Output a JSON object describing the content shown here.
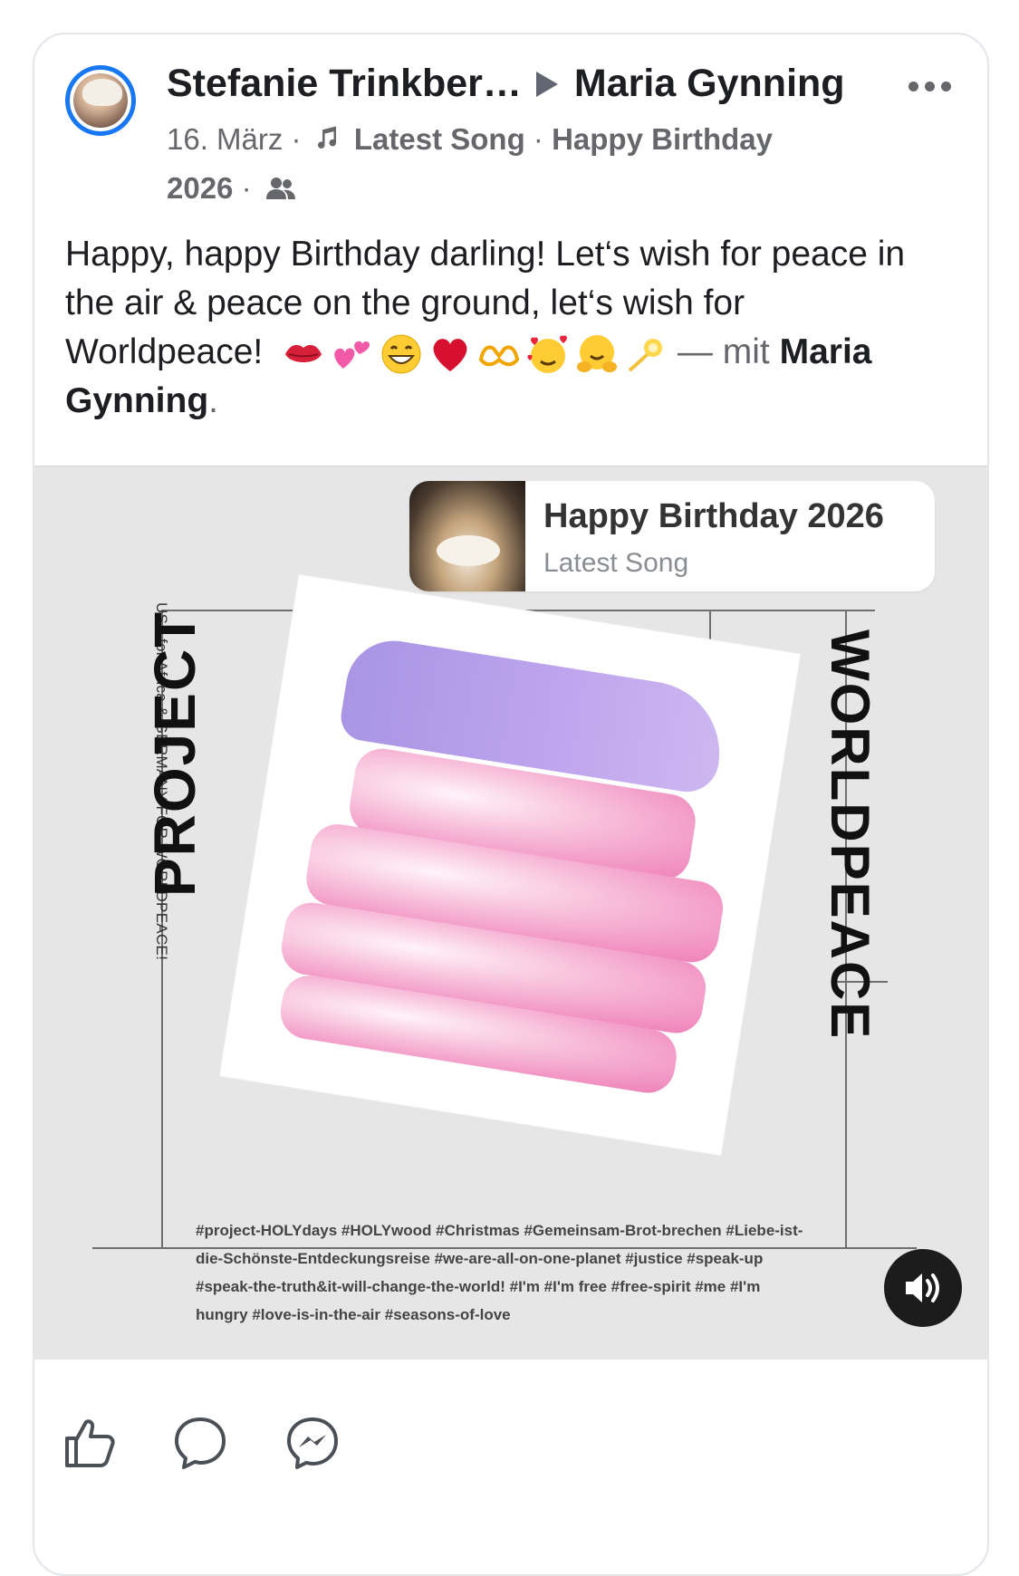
{
  "post": {
    "author": "Stefanie Trinkber…",
    "target": "Maria Gynning",
    "date": "16. März",
    "activity_label": "Latest Song",
    "separator": "·",
    "activity_song": "Happy Birthday",
    "activity_year": "2026",
    "text_main": "Happy, happy Birthday darling! Let‘s wish for peace in the air & peace on the ground, let‘s wish for Worldpeace!",
    "text_dash": "—",
    "text_with": "mit",
    "text_tag": "Maria Gynning",
    "text_end": "."
  },
  "song_card": {
    "title": "Happy Birthday 2026",
    "subtitle": "Latest Song"
  },
  "poster": {
    "side_text": "USA for Africa & GERMANY FOR WORLDPEACE!",
    "project_word": "PROJECT",
    "worldpeace_word": "WORLDPEACE",
    "hashtags": "#project-HOLYdays #HOLYwood #Christmas #Gemeinsam-Brot-brechen #Liebe-ist-die-Schönste-Entdeckungsreise #we-are-all-on-one-planet #justice #speak-up #speak-the-truth&it-will-change-the-world! #I'm #I'm free #free-spirit #me #I'm hungry #love-is-in-the-air #seasons-of-love"
  },
  "icons": {
    "more": "more-dots-icon",
    "note": "music-note-icon",
    "audience": "friends-icon",
    "sound": "speaker-icon",
    "like": "thumbs-up-icon",
    "comment": "comment-icon",
    "share": "messenger-icon"
  },
  "colors": {
    "accent": "#1877f2",
    "muted": "#65676b"
  }
}
